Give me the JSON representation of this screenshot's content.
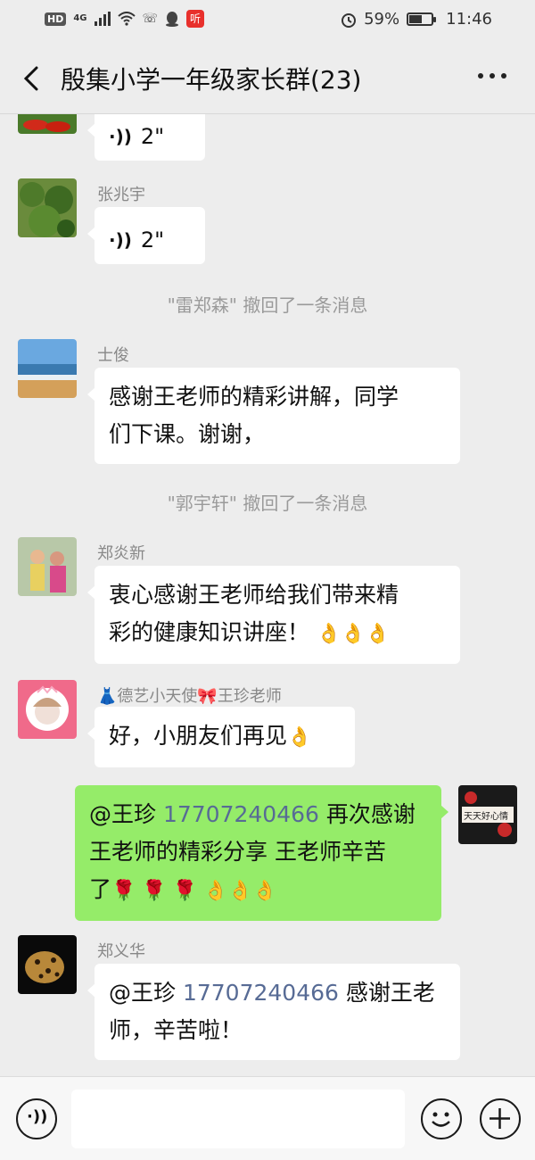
{
  "status_bar": {
    "network_labels": [
      "HD",
      "4G"
    ],
    "battery_percent": "59%",
    "battery_level": 0.59,
    "time": "11:46",
    "app_badge": "听"
  },
  "header": {
    "title": "殷集小学一年级家长群(23)"
  },
  "messages": [
    {
      "id": "m0",
      "type": "voice",
      "duration": "2\""
    },
    {
      "id": "m1",
      "type": "voice",
      "sender": "张兆宇",
      "duration": "2\""
    },
    {
      "id": "s1",
      "type": "system",
      "text": "\"雷郑森\" 撤回了一条消息"
    },
    {
      "id": "m2",
      "type": "text",
      "sender": "士俊",
      "lines": [
        "感谢王老师的精彩讲解，同学",
        "们下课。谢谢，"
      ]
    },
    {
      "id": "s2",
      "type": "system",
      "text": "\"郭宇轩\" 撤回了一条消息"
    },
    {
      "id": "m3",
      "type": "text",
      "sender": "郑炎新",
      "lines": [
        "衷心感谢王老师给我们带来精",
        "彩的健康知识讲座！"
      ],
      "emoji": "👌👌👌"
    },
    {
      "id": "m4",
      "type": "text",
      "sender": "👗德艺小天使🎀王珍老师",
      "lines": [
        "好，小朋友们再见"
      ],
      "emoji": "👌"
    },
    {
      "id": "m5",
      "type": "text",
      "mine": true,
      "mention": "@王珍",
      "phone": "17707240466",
      "lines": [
        "再次感谢",
        "王老师的精彩分享  王老师辛苦",
        "了"
      ],
      "emoji": "🌹 🌹 🌹 👌👌👌"
    },
    {
      "id": "m6",
      "type": "text",
      "sender": "郑义华",
      "mention": "@王珍",
      "phone": "17707240466",
      "lines": [
        "感谢王老",
        "师，辛苦啦！"
      ]
    }
  ],
  "self_avatar_text": "天天好心情",
  "input": {
    "value": ""
  },
  "colors": {
    "background": "#ededed",
    "bubble_in": "#ffffff",
    "bubble_out": "#95ec69",
    "mention": "#576b95",
    "system_text": "#9a9a9a"
  }
}
